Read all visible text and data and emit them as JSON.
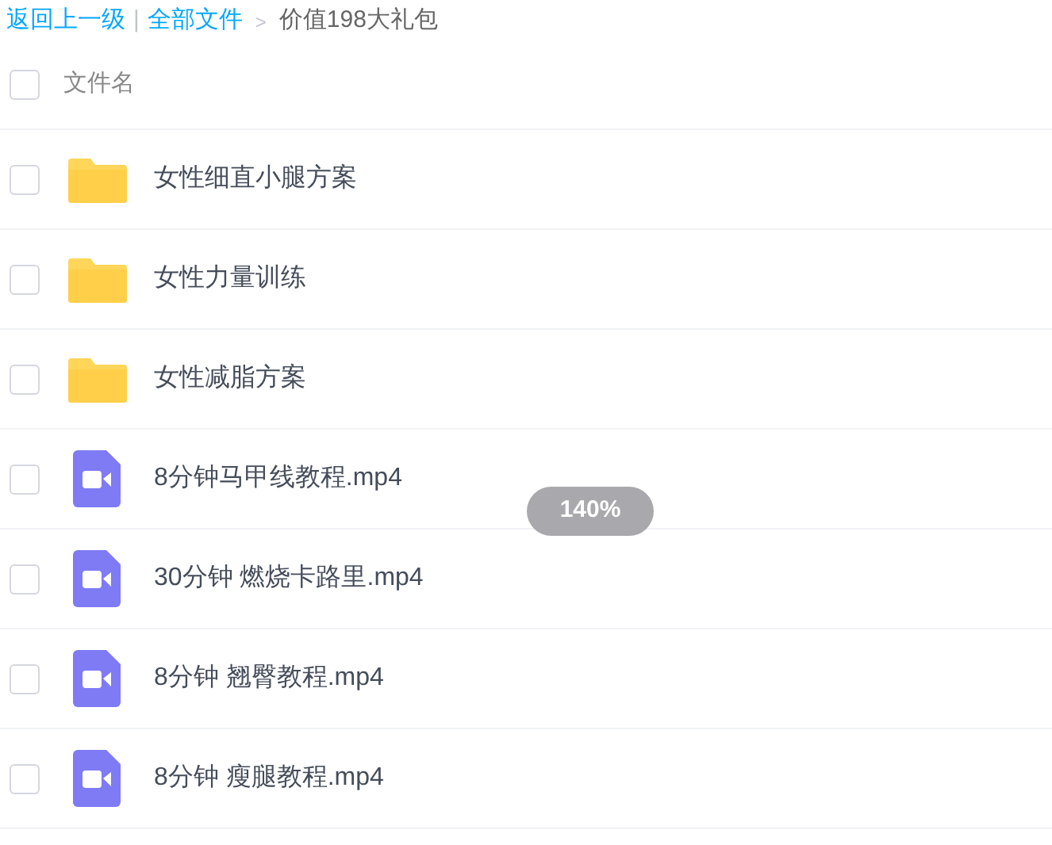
{
  "breadcrumb": {
    "back": "返回上一级",
    "separator": "|",
    "root": "全部文件",
    "arrow": ">",
    "current": "价值198大礼包"
  },
  "header": {
    "checked": false,
    "column": "文件名"
  },
  "files": [
    {
      "kind": "folder",
      "name": "女性细直小腿方案",
      "checked": false
    },
    {
      "kind": "folder",
      "name": "女性力量训练",
      "checked": false
    },
    {
      "kind": "folder",
      "name": "女性减脂方案",
      "checked": false
    },
    {
      "kind": "video",
      "name": "8分钟马甲线教程.mp4",
      "checked": false
    },
    {
      "kind": "video",
      "name": "30分钟 燃烧卡路里.mp4",
      "checked": false
    },
    {
      "kind": "video",
      "name": "8分钟 翘臀教程.mp4",
      "checked": false
    },
    {
      "kind": "video",
      "name": "8分钟 瘦腿教程.mp4",
      "checked": false
    }
  ],
  "zoom_toast": "140%"
}
